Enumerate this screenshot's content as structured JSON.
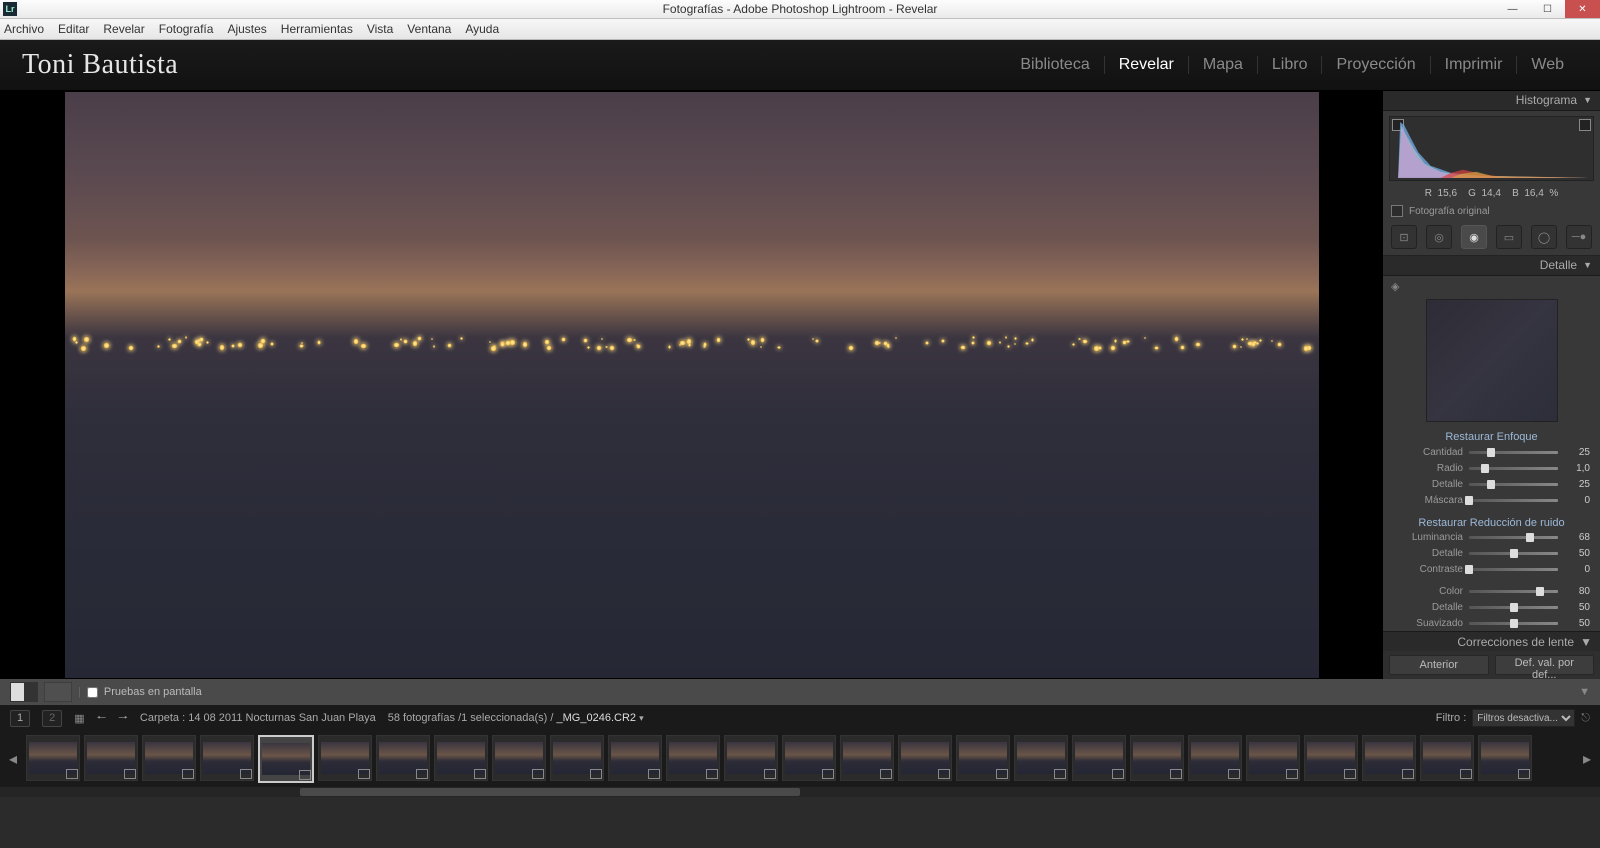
{
  "window": {
    "title": "Fotografías - Adobe Photoshop Lightroom - Revelar",
    "icon_label": "Lr"
  },
  "menu": {
    "items": [
      "Archivo",
      "Editar",
      "Revelar",
      "Fotografía",
      "Ajustes",
      "Herramientas",
      "Vista",
      "Ventana",
      "Ayuda"
    ]
  },
  "identity": "Toni Bautista",
  "modules": [
    {
      "label": "Biblioteca",
      "active": false
    },
    {
      "label": "Revelar",
      "active": true
    },
    {
      "label": "Mapa",
      "active": false
    },
    {
      "label": "Libro",
      "active": false
    },
    {
      "label": "Proyección",
      "active": false
    },
    {
      "label": "Imprimir",
      "active": false
    },
    {
      "label": "Web",
      "active": false
    }
  ],
  "histogram": {
    "title": "Histograma",
    "rgb": {
      "r_lbl": "R",
      "r": "15,6",
      "g_lbl": "G",
      "g": "14,4",
      "b_lbl": "B",
      "b": "16,4",
      "pct": "%"
    },
    "original": "Fotografía original"
  },
  "tools": [
    "crop",
    "spot",
    "redeye",
    "grad",
    "radial",
    "brush"
  ],
  "detail": {
    "title": "Detalle",
    "sharpen": {
      "header": "Restaurar Enfoque",
      "items": [
        {
          "label": "Cantidad",
          "value": "25",
          "pos": 25
        },
        {
          "label": "Radio",
          "value": "1,0",
          "pos": 18
        },
        {
          "label": "Detalle",
          "value": "25",
          "pos": 25
        },
        {
          "label": "Máscara",
          "value": "0",
          "pos": 0
        }
      ]
    },
    "noise": {
      "header": "Restaurar Reducción de ruido",
      "items": [
        {
          "label": "Luminancia",
          "value": "68",
          "pos": 68
        },
        {
          "label": "Detalle",
          "value": "50",
          "pos": 50
        },
        {
          "label": "Contraste",
          "value": "0",
          "pos": 0
        }
      ],
      "color_items": [
        {
          "label": "Color",
          "value": "80",
          "pos": 80
        },
        {
          "label": "Detalle",
          "value": "50",
          "pos": 50
        },
        {
          "label": "Suavizado",
          "value": "50",
          "pos": 50
        }
      ]
    }
  },
  "lens_panel": "Correcciones de lente",
  "footer_buttons": {
    "prev": "Anterior",
    "reset": "Def. val. por def..."
  },
  "toolbar": {
    "soft_proof": "Pruebas en pantalla"
  },
  "secondbar": {
    "page1": "1",
    "page2": "2",
    "folder": "Carpeta : 14 08 2011 Nocturnas San Juan Playa",
    "count": "58 fotografías /1 seleccionada(s) /",
    "filename": "_MG_0246.CR2",
    "filter_label": "Filtro :",
    "filter_value": "Filtros desactiva..."
  },
  "thumb_count": 26,
  "selected_thumb": 4
}
